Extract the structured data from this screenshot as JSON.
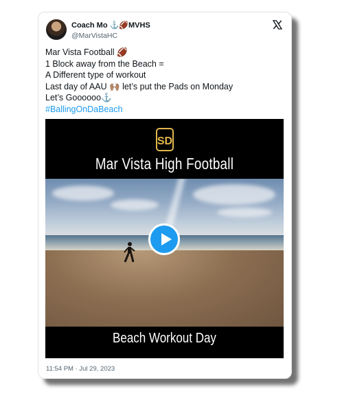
{
  "author": {
    "display_name": "Coach Mo ⚓🏈MVHS",
    "handle": "@MarVistaHC"
  },
  "tweet": {
    "lines": [
      "Mar Vista Football 🏈",
      "1 Block away from the Beach =",
      "A Different type of workout",
      "Last day of AAU 🙌🏽 let’s put the Pads on Monday",
      "Let’s  Goooooo⚓"
    ],
    "hashtag": "#BallingOnDaBeach"
  },
  "video": {
    "logo_text": "SD",
    "title": "Mar Vista High Football",
    "footer": "Beach Workout Day",
    "icon": "play-icon"
  },
  "timestamp": "11:54 PM · Jul 29, 2023",
  "icons": {
    "brand": "x-logo-icon"
  },
  "colors": {
    "link": "#1d9bf0",
    "play": "#1d9bf0",
    "logo_gold": "#e2b84b"
  }
}
